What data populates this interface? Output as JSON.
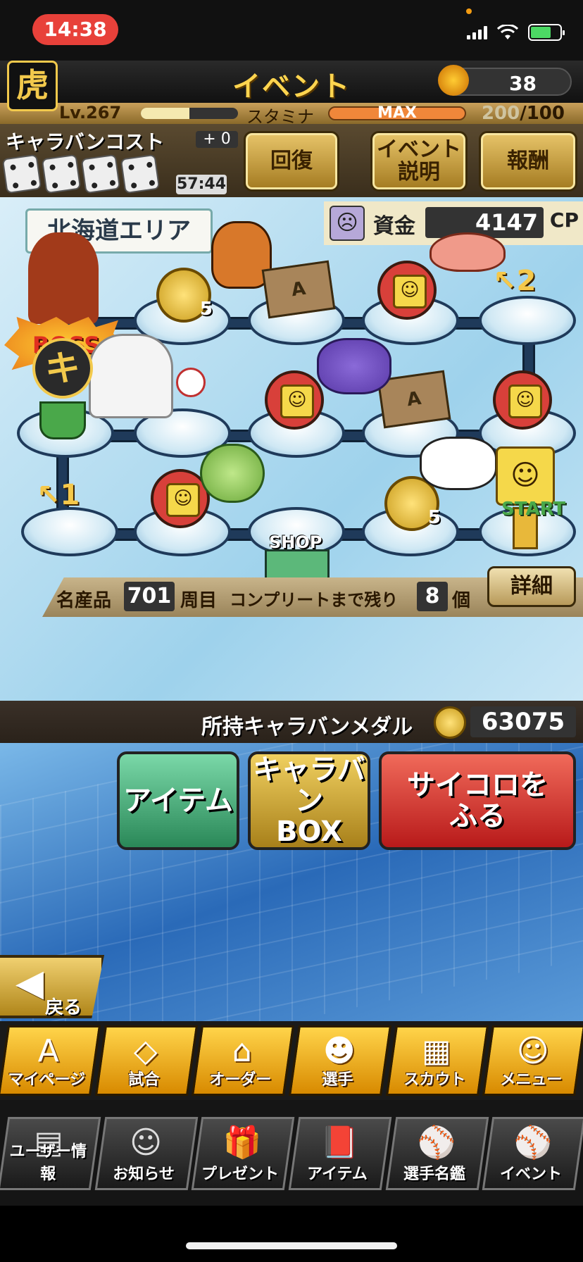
{
  "status_bar": {
    "time": "14:38"
  },
  "header": {
    "logo_glyph": "虎",
    "title": "イベント",
    "coin_count": "38"
  },
  "level": {
    "label": "Lv.267",
    "exp_fraction": 0.5,
    "stamina_label": "スタミナ",
    "stamina_bar_text": "MAX",
    "stamina_current": "200",
    "stamina_max": "/100"
  },
  "cost": {
    "title": "キャラバンコスト",
    "plus": "+ 0",
    "timer": "57:44",
    "dice_count": 4
  },
  "top_buttons": {
    "recover": "回復",
    "event_info_line1": "イベント",
    "event_info_line2": "説明",
    "reward": "報酬"
  },
  "board": {
    "area_name": "北海道エリア",
    "funds_label": "資金",
    "funds_value": "4147",
    "funds_unit": "CP",
    "boss_label": "BOSS",
    "shop_label": "SHOP",
    "coin_value": "5",
    "box_letter": "A",
    "arrow1": "1",
    "arrow2": "2",
    "start_label": "START",
    "products_label": "名産品",
    "products_value": "701",
    "products_unit": "周目",
    "complete_label": "コンプリートまで残り",
    "complete_value": "8",
    "complete_unit": "個",
    "detail_button": "詳細"
  },
  "medal": {
    "label": "所持キャラバンメダル",
    "value": "63075"
  },
  "actions": {
    "item": "アイテム",
    "caravan_box_line1": "キャラバン",
    "caravan_box_line2": "BOX",
    "roll_dice_line1": "サイコロを",
    "roll_dice_line2": "ふる"
  },
  "back_button": {
    "label": "戻る"
  },
  "nav_main": [
    {
      "label": "マイページ",
      "icon": "A"
    },
    {
      "label": "試合",
      "icon": "◇"
    },
    {
      "label": "オーダー",
      "icon": "⌂"
    },
    {
      "label": "選手",
      "icon": "☻"
    },
    {
      "label": "スカウト",
      "icon": "▦"
    },
    {
      "label": "メニュー",
      "icon": "☺"
    }
  ],
  "nav_sub": [
    {
      "label": "ユーザー情報",
      "icon": "▤"
    },
    {
      "label": "お知らせ",
      "icon": "☺"
    },
    {
      "label": "プレゼント",
      "icon": "🎁"
    },
    {
      "label": "アイテム",
      "icon": "📕"
    },
    {
      "label": "選手名鑑",
      "icon": "⚾"
    },
    {
      "label": "イベント",
      "icon": "⚾"
    }
  ],
  "colors": {
    "accent_gold": "#ffd54f",
    "stamina_orange": "#f0873a",
    "action_item": "#3aa878",
    "action_box": "#c8a030",
    "action_roll": "#d8302a"
  }
}
